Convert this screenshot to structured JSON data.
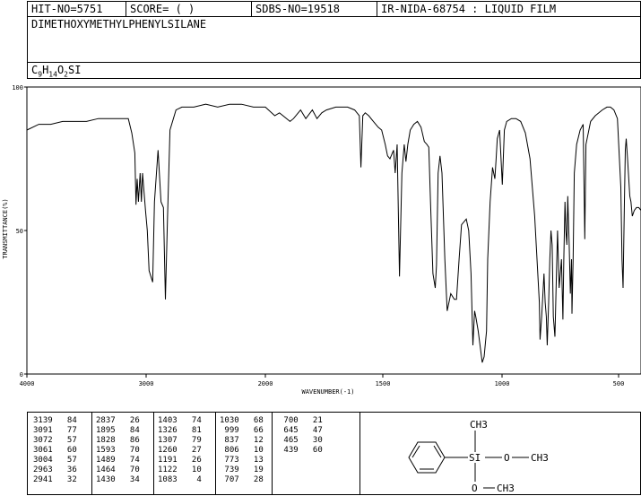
{
  "header": {
    "hit_no": "HIT-NO=5751",
    "score": "SCORE=  (   )",
    "sdbs_no": "SDBS-NO=19518",
    "method": "IR-NIDA-68754 : LIQUID FILM"
  },
  "compound_name": "DIMETHOXYMETHYLPHENYLSILANE",
  "formula": {
    "c": "C",
    "c_sub": "9",
    "h": "H",
    "h_sub": "14",
    "o": "O",
    "o_sub": "2",
    "rest": "SI"
  },
  "chart_data": {
    "type": "line",
    "xlabel": "WAVENUMBER(-1)",
    "ylabel": "TRANSMITTANCE(%)",
    "xlim": [
      4000,
      400
    ],
    "ylim": [
      0,
      100
    ],
    "x_ticks": [
      4000,
      3000,
      2000,
      1500,
      1000,
      500
    ],
    "y_ticks": [
      0,
      50,
      100
    ],
    "grid": false,
    "series": [
      {
        "points": [
          [
            4000,
            85
          ],
          [
            3900,
            87
          ],
          [
            3800,
            87
          ],
          [
            3700,
            88
          ],
          [
            3600,
            88
          ],
          [
            3500,
            88
          ],
          [
            3400,
            89
          ],
          [
            3300,
            89
          ],
          [
            3200,
            89
          ],
          [
            3150,
            89
          ],
          [
            3120,
            84
          ],
          [
            3095,
            77
          ],
          [
            3085,
            59
          ],
          [
            3075,
            68
          ],
          [
            3065,
            60
          ],
          [
            3050,
            70
          ],
          [
            3040,
            60
          ],
          [
            3030,
            70
          ],
          [
            3005,
            57
          ],
          [
            2990,
            50
          ],
          [
            2975,
            36
          ],
          [
            2960,
            34
          ],
          [
            2945,
            32
          ],
          [
            2930,
            60
          ],
          [
            2900,
            78
          ],
          [
            2875,
            60
          ],
          [
            2855,
            58
          ],
          [
            2838,
            26
          ],
          [
            2820,
            55
          ],
          [
            2800,
            85
          ],
          [
            2750,
            92
          ],
          [
            2700,
            93
          ],
          [
            2600,
            93
          ],
          [
            2500,
            94
          ],
          [
            2400,
            93
          ],
          [
            2300,
            94
          ],
          [
            2200,
            94
          ],
          [
            2100,
            93
          ],
          [
            2000,
            93
          ],
          [
            1960,
            90
          ],
          [
            1940,
            91
          ],
          [
            1895,
            88
          ],
          [
            1880,
            89
          ],
          [
            1850,
            92
          ],
          [
            1828,
            89
          ],
          [
            1800,
            92
          ],
          [
            1780,
            89
          ],
          [
            1760,
            91
          ],
          [
            1740,
            92
          ],
          [
            1700,
            93
          ],
          [
            1650,
            93
          ],
          [
            1620,
            92
          ],
          [
            1600,
            90
          ],
          [
            1593,
            72
          ],
          [
            1585,
            90
          ],
          [
            1575,
            91
          ],
          [
            1560,
            90
          ],
          [
            1540,
            88
          ],
          [
            1520,
            86
          ],
          [
            1505,
            85
          ],
          [
            1490,
            80
          ],
          [
            1480,
            76
          ],
          [
            1470,
            75
          ],
          [
            1465,
            76
          ],
          [
            1455,
            78
          ],
          [
            1448,
            70
          ],
          [
            1440,
            80
          ],
          [
            1430,
            34
          ],
          [
            1420,
            70
          ],
          [
            1410,
            80
          ],
          [
            1403,
            74
          ],
          [
            1395,
            80
          ],
          [
            1385,
            85
          ],
          [
            1370,
            87
          ],
          [
            1355,
            88
          ],
          [
            1340,
            86
          ],
          [
            1326,
            81
          ],
          [
            1315,
            80
          ],
          [
            1307,
            79
          ],
          [
            1300,
            60
          ],
          [
            1290,
            35
          ],
          [
            1280,
            30
          ],
          [
            1275,
            38
          ],
          [
            1268,
            70
          ],
          [
            1260,
            76
          ],
          [
            1252,
            70
          ],
          [
            1240,
            40
          ],
          [
            1230,
            22
          ],
          [
            1215,
            28
          ],
          [
            1200,
            26
          ],
          [
            1191,
            26
          ],
          [
            1180,
            40
          ],
          [
            1170,
            52
          ],
          [
            1150,
            54
          ],
          [
            1140,
            50
          ],
          [
            1130,
            35
          ],
          [
            1122,
            10
          ],
          [
            1115,
            22
          ],
          [
            1110,
            20
          ],
          [
            1100,
            15
          ],
          [
            1083,
            4
          ],
          [
            1075,
            6
          ],
          [
            1065,
            15
          ],
          [
            1060,
            40
          ],
          [
            1050,
            60
          ],
          [
            1040,
            72
          ],
          [
            1030,
            68
          ],
          [
            1025,
            75
          ],
          [
            1020,
            82
          ],
          [
            1010,
            85
          ],
          [
            999,
            66
          ],
          [
            990,
            85
          ],
          [
            980,
            88
          ],
          [
            960,
            89
          ],
          [
            940,
            89
          ],
          [
            920,
            88
          ],
          [
            900,
            84
          ],
          [
            880,
            75
          ],
          [
            870,
            65
          ],
          [
            860,
            55
          ],
          [
            850,
            40
          ],
          [
            840,
            25
          ],
          [
            837,
            12
          ],
          [
            830,
            20
          ],
          [
            820,
            35
          ],
          [
            815,
            25
          ],
          [
            810,
            20
          ],
          [
            806,
            10
          ],
          [
            800,
            25
          ],
          [
            795,
            40
          ],
          [
            790,
            50
          ],
          [
            785,
            45
          ],
          [
            780,
            20
          ],
          [
            773,
            13
          ],
          [
            768,
            30
          ],
          [
            762,
            50
          ],
          [
            755,
            30
          ],
          [
            750,
            35
          ],
          [
            745,
            40
          ],
          [
            739,
            19
          ],
          [
            735,
            40
          ],
          [
            730,
            60
          ],
          [
            726,
            50
          ],
          [
            722,
            45
          ],
          [
            718,
            62
          ],
          [
            712,
            45
          ],
          [
            707,
            28
          ],
          [
            702,
            40
          ],
          [
            700,
            21
          ],
          [
            695,
            40
          ],
          [
            690,
            70
          ],
          [
            680,
            80
          ],
          [
            665,
            85
          ],
          [
            652,
            87
          ],
          [
            645,
            47
          ],
          [
            640,
            80
          ],
          [
            620,
            88
          ],
          [
            600,
            90
          ],
          [
            570,
            92
          ],
          [
            550,
            93
          ],
          [
            535,
            93
          ],
          [
            520,
            92
          ],
          [
            505,
            89
          ],
          [
            490,
            65
          ],
          [
            485,
            40
          ],
          [
            480,
            30
          ],
          [
            474,
            60
          ],
          [
            470,
            78
          ],
          [
            466,
            82
          ],
          [
            460,
            75
          ],
          [
            450,
            62
          ],
          [
            445,
            60
          ],
          [
            439,
            55
          ],
          [
            430,
            57
          ],
          [
            420,
            58
          ],
          [
            410,
            58
          ],
          [
            400,
            57
          ]
        ]
      }
    ],
    "peak_table": [
      {
        "wavenumber": 3139,
        "t": 84
      },
      {
        "wavenumber": 3091,
        "t": 77
      },
      {
        "wavenumber": 3072,
        "t": 57
      },
      {
        "wavenumber": 3061,
        "t": 60
      },
      {
        "wavenumber": 3004,
        "t": 57
      },
      {
        "wavenumber": 2963,
        "t": 36
      },
      {
        "wavenumber": 2941,
        "t": 32
      },
      {
        "wavenumber": 2837,
        "t": 26
      },
      {
        "wavenumber": 1895,
        "t": 84
      },
      {
        "wavenumber": 1828,
        "t": 86
      },
      {
        "wavenumber": 1593,
        "t": 70
      },
      {
        "wavenumber": 1489,
        "t": 74
      },
      {
        "wavenumber": 1464,
        "t": 70
      },
      {
        "wavenumber": 1430,
        "t": 34
      },
      {
        "wavenumber": 1403,
        "t": 74
      },
      {
        "wavenumber": 1326,
        "t": 81
      },
      {
        "wavenumber": 1307,
        "t": 79
      },
      {
        "wavenumber": 1260,
        "t": 27
      },
      {
        "wavenumber": 1191,
        "t": 26
      },
      {
        "wavenumber": 1122,
        "t": 10
      },
      {
        "wavenumber": 1083,
        "t": 4
      },
      {
        "wavenumber": 1030,
        "t": 68
      },
      {
        "wavenumber": 999,
        "t": 66
      },
      {
        "wavenumber": 837,
        "t": 12
      },
      {
        "wavenumber": 806,
        "t": 10
      },
      {
        "wavenumber": 773,
        "t": 13
      },
      {
        "wavenumber": 739,
        "t": 19
      },
      {
        "wavenumber": 707,
        "t": 28
      },
      {
        "wavenumber": 700,
        "t": 21
      },
      {
        "wavenumber": 645,
        "t": 47
      },
      {
        "wavenumber": 465,
        "t": 30
      },
      {
        "wavenumber": 439,
        "t": 60
      }
    ]
  },
  "structure": {
    "top_label": "CH3",
    "si_label": "SI",
    "o_right": "O",
    "ch3_right": "CH3",
    "o_bottom": "O",
    "ch3_bottom": "CH3"
  }
}
